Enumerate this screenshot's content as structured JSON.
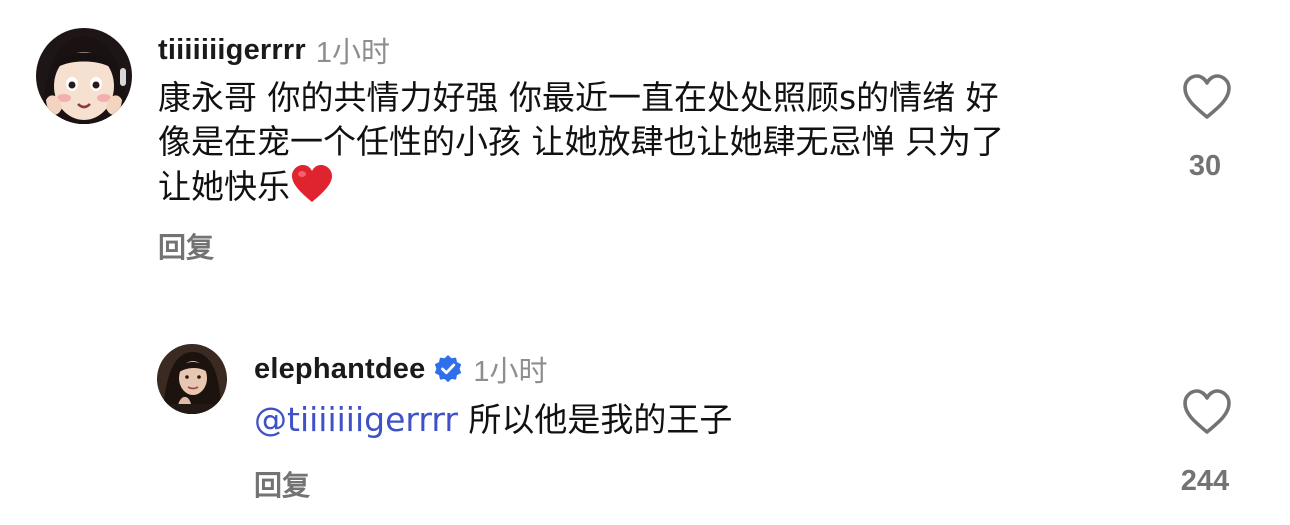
{
  "comments": [
    {
      "username": "tiiiiiiigerrrr",
      "time": "1小时",
      "text_lines": [
        "康永哥 你的共情力好强 你最近一直在处处照顾s的情绪 好",
        "像是在宠一个任性的小孩 让她放肆也让她肆无忌惮 只为了",
        "让她快乐"
      ],
      "emoji": "red-heart",
      "reply_label": "回复",
      "like_count": "30",
      "avatar": "cartoon-girl-avatar"
    },
    {
      "username": "elephantdee",
      "verified": true,
      "time": "1小时",
      "mention": "@tiiiiiiigerrrr",
      "text": " 所以他是我的王子",
      "reply_label": "回复",
      "like_count": "244",
      "avatar": "woman-photo-avatar"
    }
  ],
  "colors": {
    "mention": "#3f51c8",
    "verified_badge": "#2f6fec",
    "secondary_text": "#737373",
    "heart_emoji": "#e0242f"
  }
}
